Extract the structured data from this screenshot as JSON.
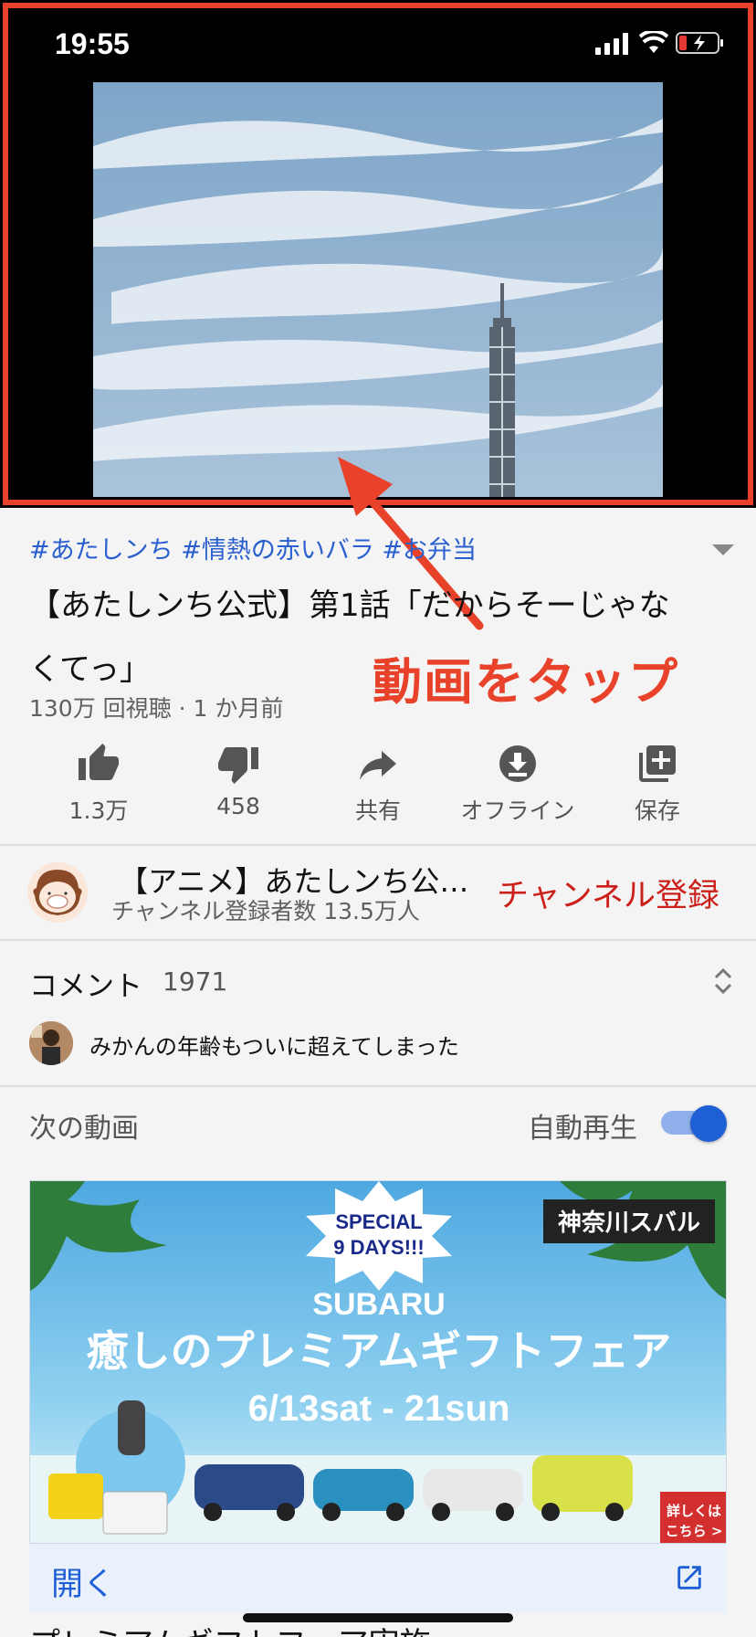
{
  "status_bar": {
    "time": "19:55"
  },
  "annotation": {
    "tap_label": "動画をタップ",
    "highlight_color": "#e8432a"
  },
  "video": {
    "hashtags": "#あたしンち #情熱の赤いバラ #お弁当",
    "title": "【あたしンち公式】第1話「だからそーじゃなくてっ」",
    "meta": "130万 回視聴 · 1 か月前"
  },
  "actions": [
    {
      "label": "1.3万",
      "icon": "thumb-up-icon"
    },
    {
      "label": "458",
      "icon": "thumb-down-icon"
    },
    {
      "label": "共有",
      "icon": "share-icon"
    },
    {
      "label": "オフライン",
      "icon": "download-icon"
    },
    {
      "label": "保存",
      "icon": "add-to-playlist-icon"
    }
  ],
  "channel": {
    "name": "【アニメ】あたしンち公式チャンネル",
    "subscribers": "チャンネル登録者数 13.5万人",
    "subscribe_label": "チャンネル登録"
  },
  "comments": {
    "label": "コメント",
    "count": "1971",
    "top_comment": "みかんの年齢もついに超えてしまった"
  },
  "up_next": {
    "label": "次の動画",
    "autoplay_label": "自動再生",
    "autoplay_on": true
  },
  "ad": {
    "badge": "SPECIAL 9 DAYS!!!",
    "badge_line1": "SPECIAL",
    "badge_line2": "9 DAYS!!!",
    "dealer": "神奈川スバル",
    "brand": "SUBARU",
    "headline": "癒しのプレミアムギフトフェア",
    "dates": "6/13sat - 21sun",
    "details_line1": "詳しくは",
    "details_line2": "こちら >",
    "open_label": "開く"
  },
  "next_video_title": "プレミアムギフトフェア実施"
}
